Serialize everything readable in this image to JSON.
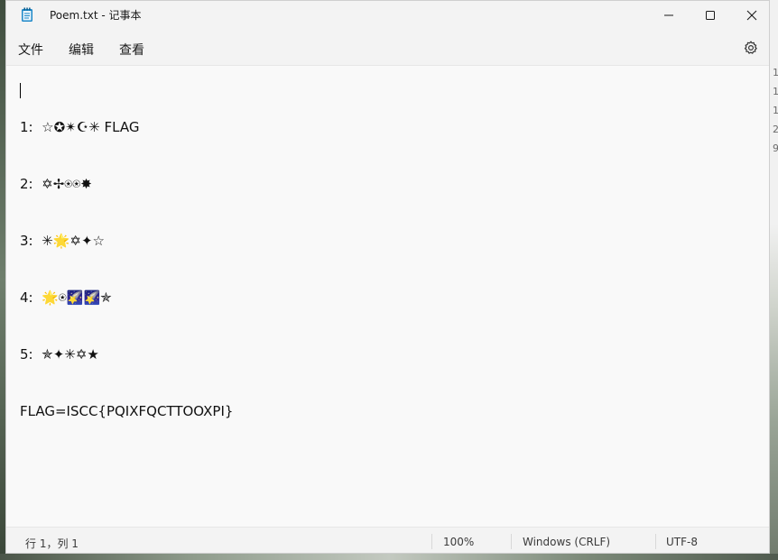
{
  "window": {
    "title": "Poem.txt - 记事本"
  },
  "menu": {
    "file": "文件",
    "edit": "编辑",
    "view": "查看"
  },
  "editor": {
    "lines": [
      "1:  ☆✪✴☪✳ FLAG",
      "2:  ✡✢⍟⍟✸",
      "3:  ✳🌟✡✦☆",
      "4:  🌟⍟🌠🌠✯",
      "5:  ✯✦✳✡★",
      "FLAG=ISCC{PQIXFQCTTOOXPI}"
    ]
  },
  "status": {
    "position": "行 1，列 1",
    "zoom": "100%",
    "line_ending": "Windows (CRLF)",
    "encoding": "UTF-8"
  },
  "background_peek": [
    "1",
    "1",
    "1",
    "2",
    "9"
  ],
  "icons": {
    "app": "notepad-icon",
    "minimize": "minimize-icon",
    "maximize": "maximize-icon",
    "close": "close-icon",
    "settings": "gear-icon"
  },
  "colors": {
    "window_bg": "#f9f9f9",
    "chrome_bg": "#f3f3f3",
    "text": "#111111"
  }
}
